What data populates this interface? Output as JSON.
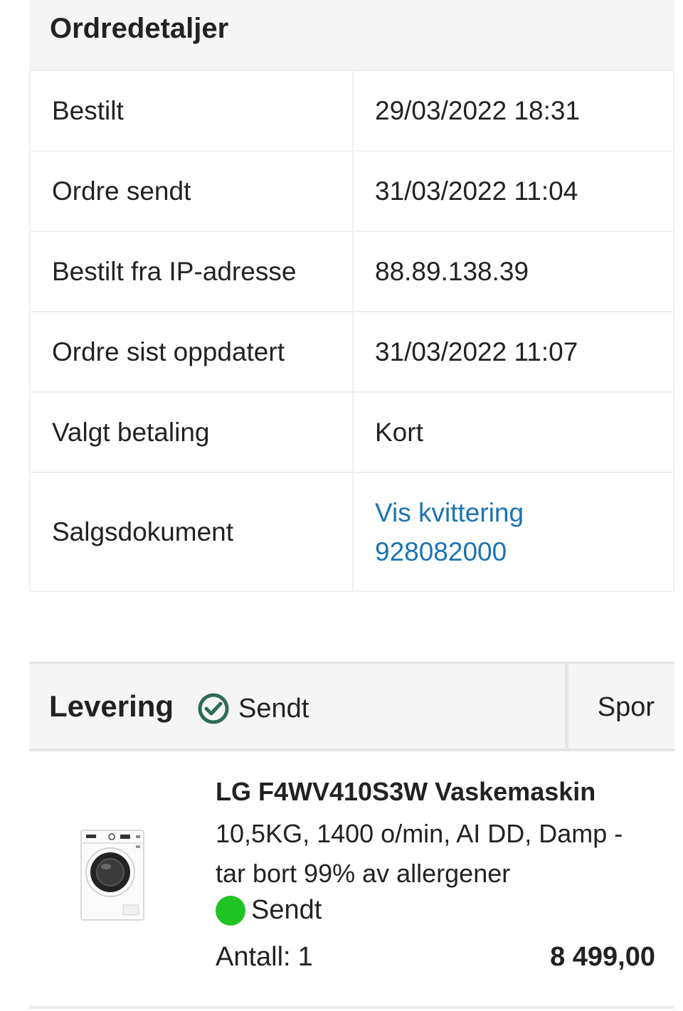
{
  "order_details": {
    "title": "Ordredetaljer",
    "rows": [
      {
        "label": "Bestilt",
        "value": "29/03/2022 18:31"
      },
      {
        "label": "Ordre sendt",
        "value": "31/03/2022 11:04"
      },
      {
        "label": "Bestilt fra IP-adresse",
        "value": "88.89.138.39"
      },
      {
        "label": "Ordre sist oppdatert",
        "value": "31/03/2022 11:07"
      },
      {
        "label": "Valgt betaling",
        "value": "Kort"
      }
    ],
    "sales_document": {
      "label": "Salgsdokument",
      "link_text": "Vis kvittering",
      "document_number": "928082000"
    }
  },
  "delivery": {
    "title": "Levering",
    "status_icon": "check-circle-icon",
    "status": "Sendt",
    "track_label": "Spor"
  },
  "product": {
    "image_icon": "washing-machine-image",
    "name": "LG F4WV410S3W Vaskemaskin",
    "description": "10,5KG, 1400 o/min, AI DD, Damp - tar bort 99% av allergener",
    "status": "Sendt",
    "quantity_label": "Antall:",
    "quantity": "1",
    "price": "8 499,00"
  },
  "colors": {
    "link": "#1a73b2",
    "status_green": "#1fc324",
    "check_icon": "#2e6b53",
    "header_bg": "#f5f5f5"
  }
}
